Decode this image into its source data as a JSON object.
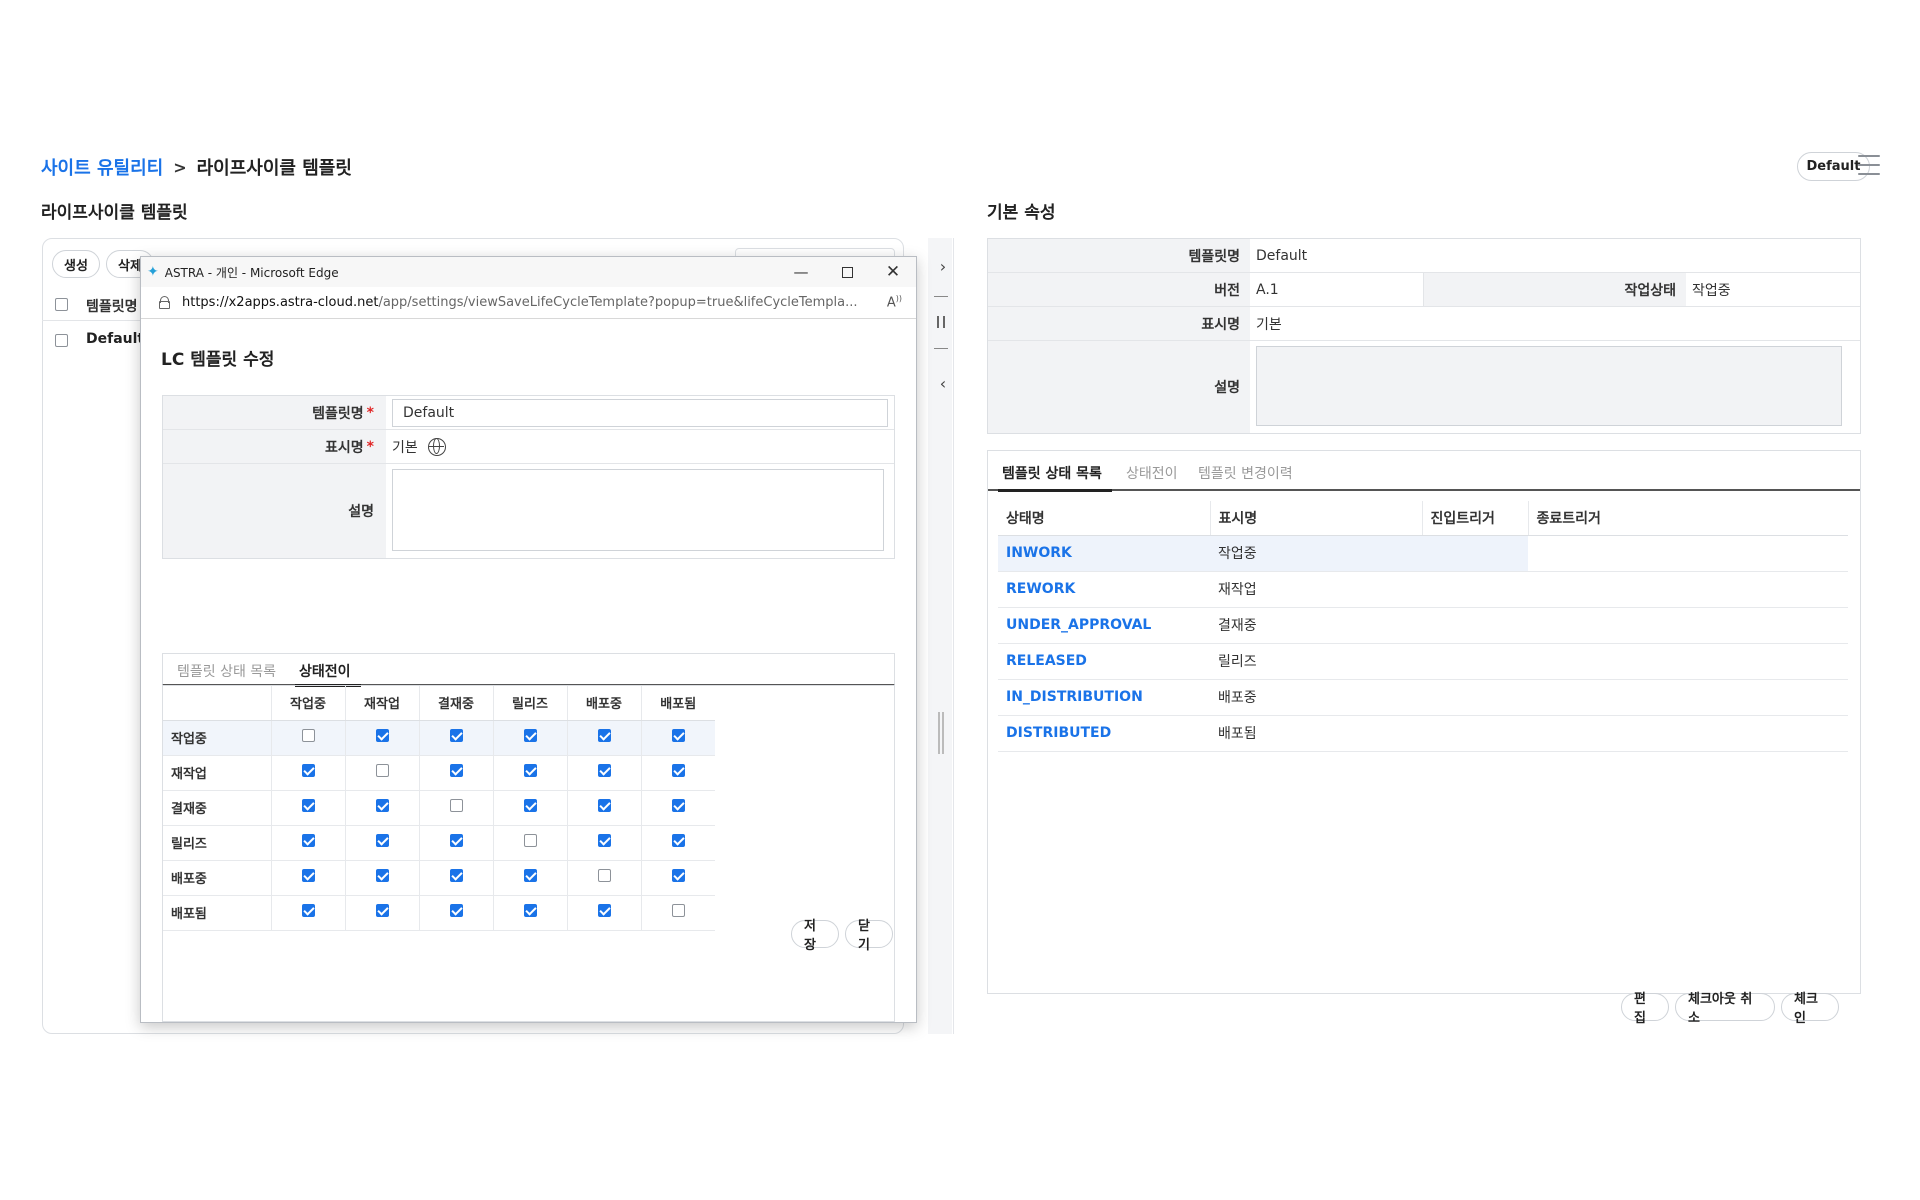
{
  "breadcrumb": {
    "root": "사이트 유틸리티",
    "separator": ">",
    "current": "라이프사이클 템플릿"
  },
  "left": {
    "title": "라이프사이클 템플릿",
    "buttons": {
      "create": "생성",
      "delete": "삭제"
    },
    "list_header": "템플릿명",
    "rows": [
      "Default"
    ]
  },
  "header_right": {
    "default_badge": "Default"
  },
  "popup": {
    "window_title": "ASTRA - 개인 - Microsoft Edge",
    "url_host": "https://x2apps.astra-cloud.net",
    "url_path": "/app/settings/viewSaveLifeCycleTemplate?popup=true&lifeCycleTempla...",
    "title": "LC 템플릿 수정",
    "fields": {
      "template_name_label": "템플릿명",
      "template_name_value": "Default",
      "display_name_label": "표시명",
      "display_name_value": "기본",
      "description_label": "설명",
      "required_mark": "*"
    },
    "tabs": [
      "템플릿 상태 목록",
      "상태전이"
    ],
    "active_tab": 1,
    "matrix": {
      "columns": [
        "작업중",
        "재작업",
        "결재중",
        "릴리즈",
        "배포중",
        "배포됨"
      ],
      "rows": [
        {
          "label": "작업중",
          "checks": [
            false,
            true,
            true,
            true,
            true,
            true
          ]
        },
        {
          "label": "재작업",
          "checks": [
            true,
            false,
            true,
            true,
            true,
            true
          ]
        },
        {
          "label": "결재중",
          "checks": [
            true,
            true,
            false,
            true,
            true,
            true
          ]
        },
        {
          "label": "릴리즈",
          "checks": [
            true,
            true,
            true,
            false,
            true,
            true
          ]
        },
        {
          "label": "배포중",
          "checks": [
            true,
            true,
            true,
            true,
            false,
            true
          ]
        },
        {
          "label": "배포됨",
          "checks": [
            true,
            true,
            true,
            true,
            true,
            false
          ]
        }
      ]
    },
    "buttons": {
      "save": "저장",
      "close": "닫기"
    }
  },
  "right": {
    "title": "기본 속성",
    "props": {
      "template_name_label": "템플릿명",
      "template_name_value": "Default",
      "version_label": "버전",
      "version_value": "A.1",
      "work_state_label": "작업상태",
      "work_state_value": "작업중",
      "display_name_label": "표시명",
      "display_name_value": "기본",
      "description_label": "설명"
    },
    "tabs": [
      "템플릿 상태 목록",
      "상태전이",
      "템플릿 변경이력"
    ],
    "active_tab": 0,
    "state_table": {
      "headers": [
        "상태명",
        "표시명",
        "진입트리거",
        "종료트리거"
      ],
      "rows": [
        {
          "code": "INWORK",
          "name": "작업중"
        },
        {
          "code": "REWORK",
          "name": "재작업"
        },
        {
          "code": "UNDER_APPROVAL",
          "name": "결재중"
        },
        {
          "code": "RELEASED",
          "name": "릴리즈"
        },
        {
          "code": "IN_DISTRIBUTION",
          "name": "배포중"
        },
        {
          "code": "DISTRIBUTED",
          "name": "배포됨"
        }
      ]
    },
    "buttons": {
      "edit": "편집",
      "cancel_checkout": "체크아웃 취소",
      "checkin": "체크인"
    }
  }
}
